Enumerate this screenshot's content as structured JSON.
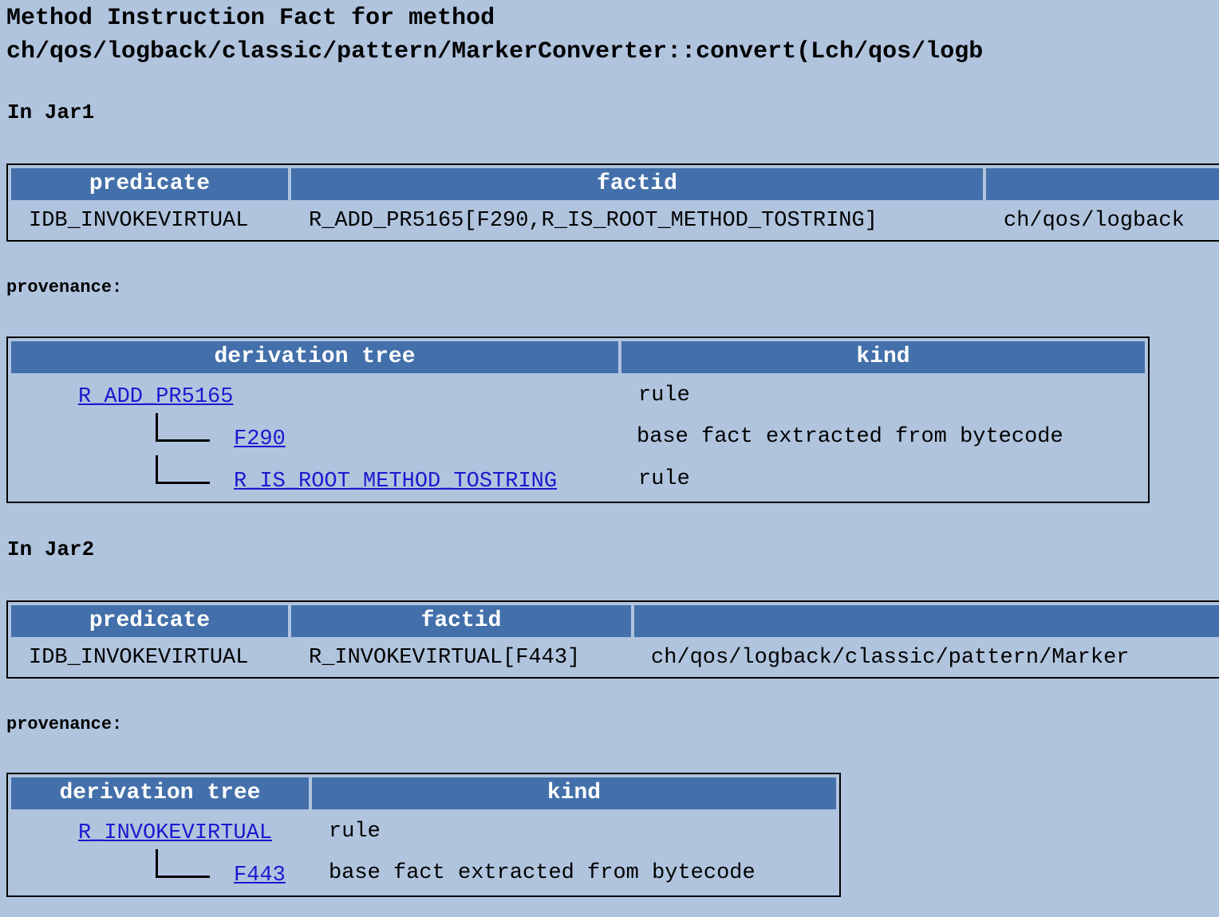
{
  "title": {
    "line1": "Method Instruction Fact for method",
    "line2": "ch/qos/logback/classic/pattern/MarkerConverter::convert(Lch/qos/logb"
  },
  "jar1": {
    "heading": "In Jar1",
    "fact_table": {
      "headers": [
        "predicate",
        "factid",
        ""
      ],
      "row": [
        "IDB_INVOKEVIRTUAL",
        "R_ADD_PR5165[F290,R_IS_ROOT_METHOD_TOSTRING]",
        "ch/qos/logback"
      ]
    },
    "provenance_label": "provenance:",
    "provenance": {
      "headers": [
        "derivation tree",
        "kind"
      ],
      "rows": [
        {
          "node": "R_ADD_PR5165",
          "kind": "rule"
        },
        {
          "node": "F290",
          "kind": "base fact extracted from bytecode"
        },
        {
          "node": "R_IS_ROOT_METHOD_TOSTRING",
          "kind": "rule"
        }
      ]
    }
  },
  "jar2": {
    "heading": "In Jar2",
    "fact_table": {
      "headers": [
        "predicate",
        "factid",
        ""
      ],
      "row": [
        "IDB_INVOKEVIRTUAL",
        "R_INVOKEVIRTUAL[F443]",
        "ch/qos/logback/classic/pattern/Marker"
      ]
    },
    "provenance_label": "provenance:",
    "provenance": {
      "headers": [
        "derivation tree",
        "kind"
      ],
      "rows": [
        {
          "node": "R_INVOKEVIRTUAL",
          "kind": "rule"
        },
        {
          "node": "F443",
          "kind": "base fact extracted from bytecode"
        }
      ]
    }
  }
}
